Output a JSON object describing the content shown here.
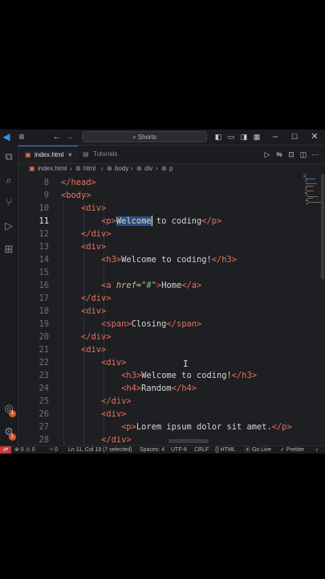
{
  "titlebar": {
    "search_placeholder": "Shorts",
    "search_icon": "search-icon",
    "back_icon": "←",
    "forward_icon": "→",
    "menu_icon": "≡"
  },
  "tabs": [
    {
      "label": "index.html",
      "close": "×",
      "active": true
    },
    {
      "label": "Tutorials",
      "active": false
    }
  ],
  "breadcrumb": [
    "index.html",
    "html",
    "body",
    "div",
    "p"
  ],
  "editor": {
    "cursor_line": 11,
    "lines": [
      {
        "num": "8",
        "indent": 0,
        "tokens": [
          {
            "t": "tag",
            "v": "</head>"
          }
        ]
      },
      {
        "num": "9",
        "indent": 0,
        "tokens": [
          {
            "t": "tag",
            "v": "<body>"
          }
        ]
      },
      {
        "num": "10",
        "indent": 1,
        "tokens": [
          {
            "t": "tag",
            "v": "<div>"
          }
        ]
      },
      {
        "num": "11",
        "indent": 2,
        "tokens": [
          {
            "t": "tag",
            "v": "<p>"
          },
          {
            "t": "sel",
            "v": "Welcome"
          },
          {
            "t": "text",
            "v": " to coding"
          },
          {
            "t": "tag",
            "v": "</p>"
          }
        ]
      },
      {
        "num": "12",
        "indent": 1,
        "tokens": [
          {
            "t": "tag",
            "v": "</div>"
          }
        ]
      },
      {
        "num": "13",
        "indent": 1,
        "tokens": [
          {
            "t": "tag",
            "v": "<div>"
          }
        ]
      },
      {
        "num": "14",
        "indent": 2,
        "tokens": [
          {
            "t": "tag",
            "v": "<h3>"
          },
          {
            "t": "text",
            "v": "Welcome to coding!"
          },
          {
            "t": "tag",
            "v": "</h3>"
          }
        ]
      },
      {
        "num": "15",
        "indent": 0,
        "tokens": []
      },
      {
        "num": "16",
        "indent": 2,
        "tokens": [
          {
            "t": "tag",
            "v": "<a "
          },
          {
            "t": "attr",
            "v": "href"
          },
          {
            "t": "eq",
            "v": "="
          },
          {
            "t": "str",
            "v": "\"#\""
          },
          {
            "t": "tag",
            "v": ">"
          },
          {
            "t": "text",
            "v": "Home"
          },
          {
            "t": "tag",
            "v": "</a>"
          }
        ]
      },
      {
        "num": "17",
        "indent": 1,
        "tokens": [
          {
            "t": "tag",
            "v": "</div>"
          }
        ]
      },
      {
        "num": "18",
        "indent": 1,
        "tokens": [
          {
            "t": "tag",
            "v": "<div>"
          }
        ]
      },
      {
        "num": "19",
        "indent": 2,
        "tokens": [
          {
            "t": "tag",
            "v": "<span>"
          },
          {
            "t": "text",
            "v": "Closing"
          },
          {
            "t": "tag",
            "v": "</span>"
          }
        ]
      },
      {
        "num": "20",
        "indent": 1,
        "tokens": [
          {
            "t": "tag",
            "v": "</div>"
          }
        ]
      },
      {
        "num": "21",
        "indent": 1,
        "tokens": [
          {
            "t": "tag",
            "v": "<div>"
          }
        ]
      },
      {
        "num": "22",
        "indent": 2,
        "tokens": [
          {
            "t": "tag",
            "v": "<div>"
          }
        ]
      },
      {
        "num": "23",
        "indent": 3,
        "tokens": [
          {
            "t": "tag",
            "v": "<h3>"
          },
          {
            "t": "text",
            "v": "Welcome to coding!"
          },
          {
            "t": "tag",
            "v": "</h3>"
          }
        ]
      },
      {
        "num": "24",
        "indent": 3,
        "tokens": [
          {
            "t": "tag",
            "v": "<h4>"
          },
          {
            "t": "text",
            "v": "Random"
          },
          {
            "t": "tag",
            "v": "</h4>"
          }
        ]
      },
      {
        "num": "25",
        "indent": 2,
        "tokens": [
          {
            "t": "tag",
            "v": "</div>"
          }
        ]
      },
      {
        "num": "26",
        "indent": 2,
        "tokens": [
          {
            "t": "tag",
            "v": "<div>"
          }
        ]
      },
      {
        "num": "27",
        "indent": 3,
        "tokens": [
          {
            "t": "tag",
            "v": "<p>"
          },
          {
            "t": "text",
            "v": "Lorem ipsum dolor sit amet."
          },
          {
            "t": "tag",
            "v": "</p>"
          }
        ]
      },
      {
        "num": "28",
        "indent": 2,
        "tokens": [
          {
            "t": "tag",
            "v": "</div>"
          }
        ]
      }
    ]
  },
  "statusbar": {
    "remote": "⇄",
    "errors": "⊗ 0 ⚠ 0",
    "ports": "⑂ 0",
    "position": "Ln 11, Col 19 (7 selected)",
    "spaces": "Spaces: 4",
    "encoding": "UTF-8",
    "eol": "CRLF",
    "language": "{} HTML",
    "golive": "⦿ Go Live",
    "prettier": "✓ Prettier"
  },
  "badges": {
    "account": "1",
    "settings": "1"
  },
  "colors": {
    "tag": "#e5735b",
    "attribute": "#d7b86e",
    "string": "#8fbf74",
    "selection": "#2d4f7a",
    "accent": "#3c7ce8"
  }
}
